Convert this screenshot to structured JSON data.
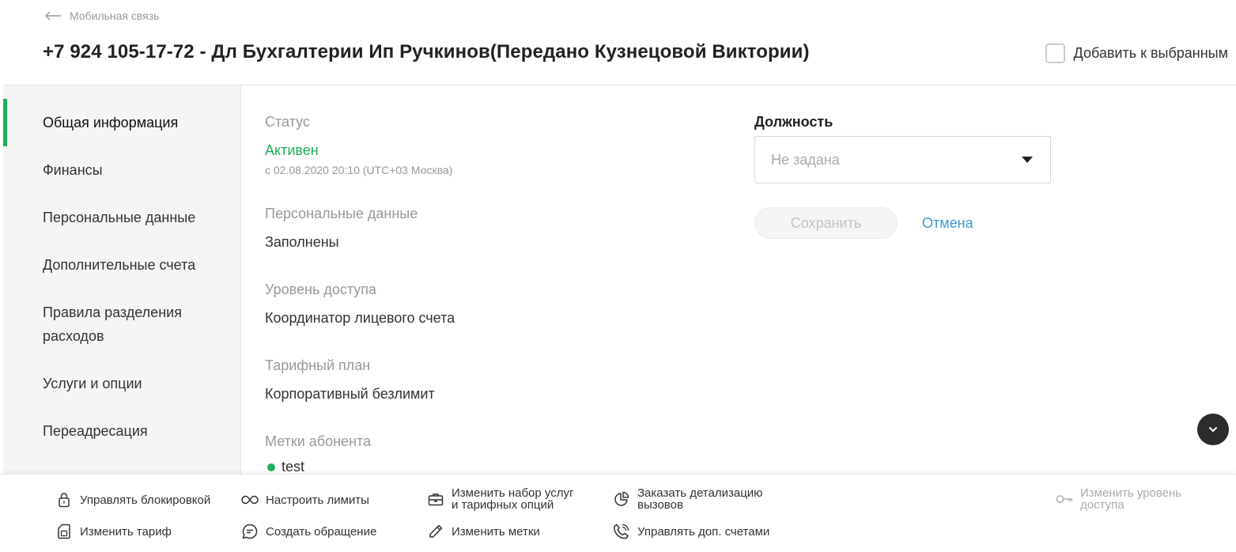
{
  "header": {
    "back_label": "Мобильная связь",
    "title": "+7 924 105-17-72 - Дл Бухгалтерии Ип Ручкинов(Передано Кузнецовой Виктории)",
    "favorite_label": "Добавить к выбранным"
  },
  "sidebar": {
    "items": [
      {
        "label": "Общая информация",
        "active": true
      },
      {
        "label": "Финансы"
      },
      {
        "label": "Персональные данные"
      },
      {
        "label": "Дополнительные счета"
      },
      {
        "label": "Правила разделения расходов"
      },
      {
        "label": "Услуги и опции"
      },
      {
        "label": "Переадресация"
      }
    ],
    "accent_color": "#1fae5b"
  },
  "info": {
    "status_label": "Статус",
    "status_value": "Активен",
    "status_since": "с 02.08.2020 20:10 (UTC+03 Москва)",
    "personal_label": "Персональные данные",
    "personal_value": "Заполнены",
    "access_label": "Уровень доступа",
    "access_value": "Координатор лицевого счета",
    "tariff_label": "Тарифный план",
    "tariff_value": "Корпоративный безлимит",
    "tags_label": "Метки абонента",
    "tags": [
      "test"
    ]
  },
  "position": {
    "label": "Должность",
    "selected": "Не задана",
    "save_label": "Сохранить",
    "cancel_label": "Отмена"
  },
  "actions": {
    "manage_block": "Управлять блокировкой",
    "set_limits": "Настроить лимиты",
    "change_services_1": "Изменить набор услуг",
    "change_services_2": "и тарифных опций",
    "order_details_1": "Заказать детализацию",
    "order_details_2": "вызовов",
    "change_access_1": "Изменить уровень",
    "change_access_2": "доступа",
    "change_tariff": "Изменить тариф",
    "create_request": "Создать обращение",
    "change_tags": "Изменить метки",
    "manage_accounts": "Управлять доп. счетами"
  },
  "colors": {
    "accent": "#1fae5b",
    "link": "#3b99d9"
  }
}
